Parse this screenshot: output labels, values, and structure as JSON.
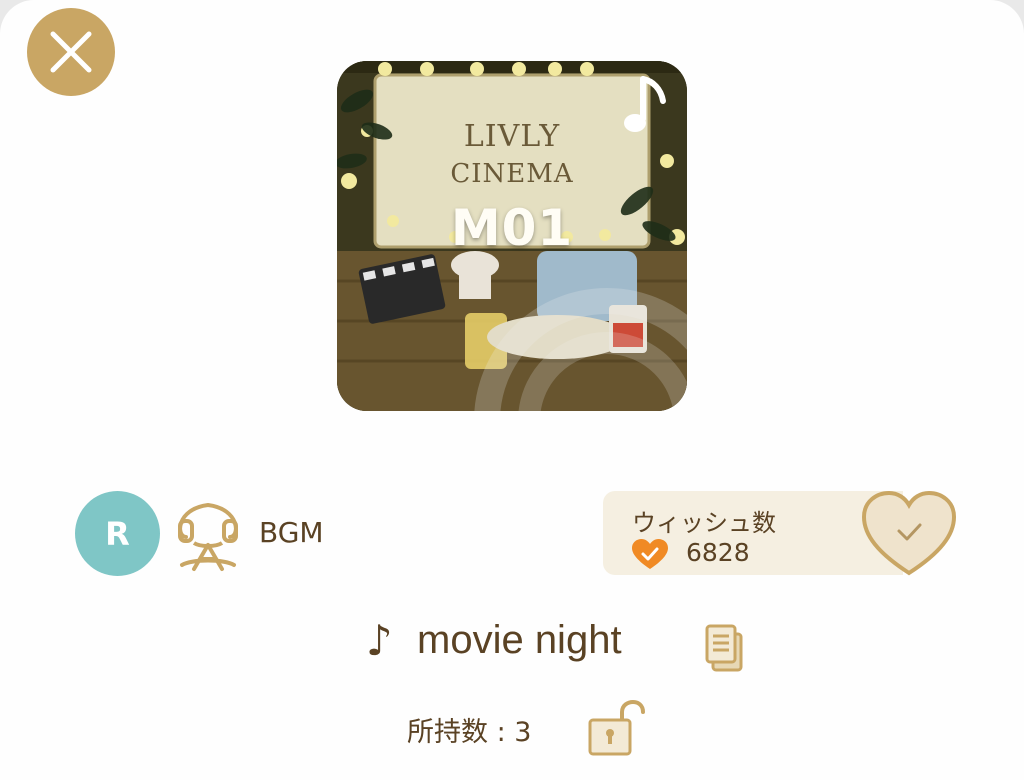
{
  "header": {
    "close_icon": "close-x-icon"
  },
  "thumbnail": {
    "brand_line1": "LIVLY",
    "brand_line2": "CINEMA",
    "code": "M01",
    "badge_icon": "music-note-icon"
  },
  "meta": {
    "rank": "R",
    "category_icon": "audio-headset-icon",
    "category": "BGM"
  },
  "wish": {
    "label": "ウィッシュ数",
    "count": "6828",
    "heart_icon": "heart-check-icon",
    "toggle_icon": "heart-check-outline-icon"
  },
  "item": {
    "note_glyph": "♪",
    "title": "movie night",
    "doc_icon": "document-icon"
  },
  "owned": {
    "text": "所持数 : 3",
    "lock_icon": "unlocked-padlock-icon"
  },
  "colors": {
    "accent_gold": "#c9a664",
    "text_brown": "#5a4224",
    "rank_teal": "#7fc6c6",
    "wish_bg": "#f5efe1",
    "heart_orange": "#f08a24"
  }
}
